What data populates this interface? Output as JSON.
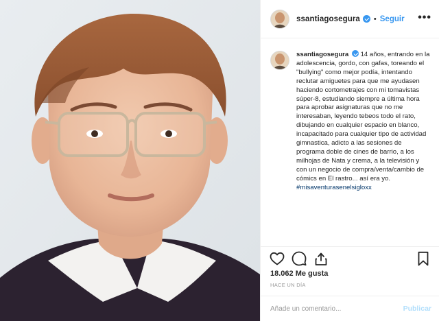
{
  "post": {
    "author": "ssantiagosegura",
    "follow_label": "Seguir",
    "more_label": "•••",
    "separator": "•",
    "caption_user": "ssantiagosegura",
    "caption_text": "14 años, entrando en la adolescencia, gordo, con gafas, toreando el \"bullying\" como mejor podía, intentando reclutar amiguetes para que me ayudasen haciendo cortometrajes con mi tomavistas súper-8, estudiando siempre a última hora para aprobar asignaturas que no me interesaban, leyendo tebeos todo el rato, dibujando en cualquier espacio en blanco, incapacitado para cualquier tipo de actividad gimnastica, adicto a las sesiones de programa doble de cines de barrio, a los milhojas de Nata y crema, a la televisión y con un negocio de compra/venta/cambio de cómics en El rastro... así era yo.",
    "hashtag": "#misaventurasenelsigloxx",
    "likes": "18.062 Me gusta",
    "time_ago": "HACE UN DÍA"
  },
  "comment_box": {
    "placeholder": "Añade un comentario...",
    "publish_label": "Publicar"
  },
  "colors": {
    "accent": "#3897f0",
    "publish_disabled": "#b2dffc",
    "hashtag": "#003569",
    "muted": "#999999"
  },
  "icons": [
    "verified-badge-icon",
    "heart-icon",
    "comment-icon",
    "share-icon",
    "bookmark-icon"
  ]
}
